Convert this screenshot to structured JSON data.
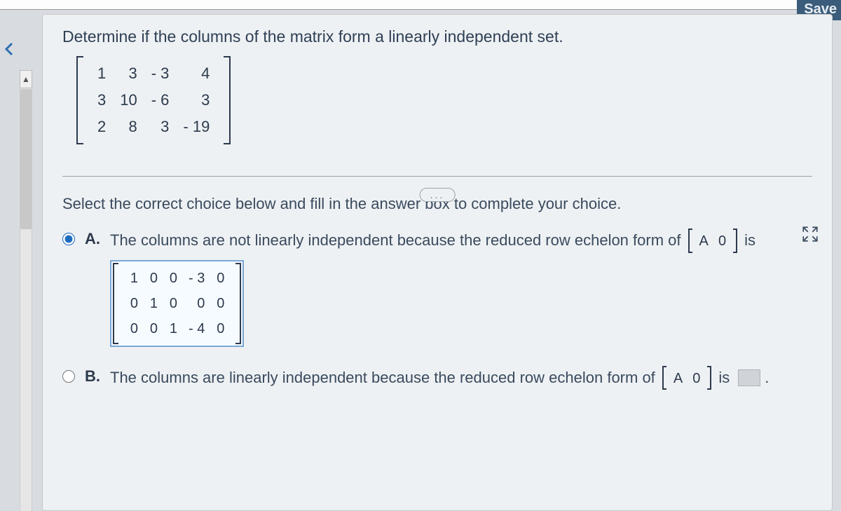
{
  "toolbar": {
    "save": "Save"
  },
  "question": "Determine if the columns of the matrix form a linearly independent set.",
  "matrix_rows": [
    [
      "1",
      "3",
      "- 3",
      "4"
    ],
    [
      "3",
      "10",
      "- 6",
      "3"
    ],
    [
      "2",
      "8",
      "3",
      "- 19"
    ]
  ],
  "ellipsis": "...",
  "instruction": "Select the correct choice below and fill in the answer box to complete your choice.",
  "choices": {
    "A": {
      "label": "A.",
      "text_before": "The columns are not linearly independent because the reduced row echelon form of",
      "inline_matrix": [
        "A",
        "0"
      ],
      "text_after": "is",
      "answer_rows": [
        [
          "1",
          "0",
          "0",
          "- 3",
          "0"
        ],
        [
          "0",
          "1",
          "0",
          "0",
          "0"
        ],
        [
          "0",
          "0",
          "1",
          "- 4",
          "0"
        ]
      ],
      "selected": true
    },
    "B": {
      "label": "B.",
      "text_before": "The columns are linearly independent because the reduced row echelon form of",
      "inline_matrix": [
        "A",
        "0"
      ],
      "text_after": "is",
      "selected": false
    }
  }
}
